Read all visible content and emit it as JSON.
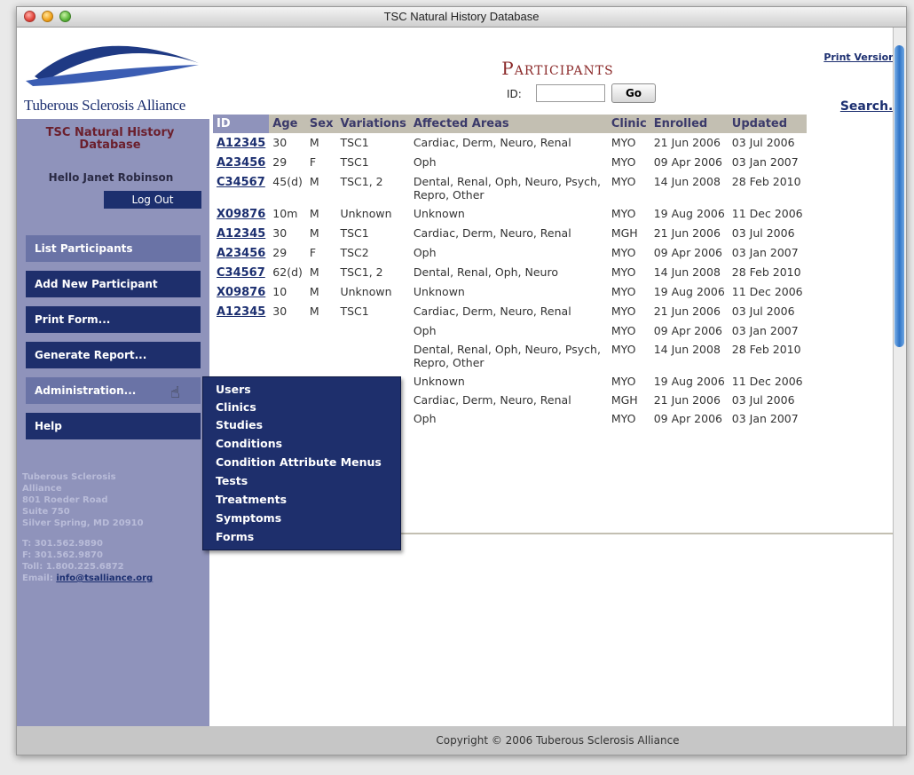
{
  "window": {
    "title": "TSC Natural History Database"
  },
  "sidebar": {
    "logo_text": "Tuberous Sclerosis Alliance",
    "db_title": "TSC Natural History Database",
    "hello": "Hello Janet Robinson",
    "logout": "Log Out",
    "nav": [
      "List Participants",
      "Add New Participant",
      "Print Form...",
      "Generate Report...",
      "Administration...",
      "Help"
    ],
    "address": {
      "line1": "Tuberous Sclerosis",
      "line2": "Alliance",
      "line3": "801 Roeder Road",
      "line4": "Suite 750",
      "line5": "Silver Spring, MD 20910",
      "phone": "T: 301.562.9890",
      "fax": "F: 301.562.9870",
      "tollfree": "Toll: 1.800.225.6872",
      "email_label": "Email:",
      "email": "info@tsalliance.org"
    }
  },
  "main": {
    "title": "Participants",
    "print_version": "Print Version",
    "id_label": "ID:",
    "id_value": "",
    "go": "Go",
    "search": "Search...",
    "columns": [
      "ID",
      "Age",
      "Sex",
      "Variations",
      "Affected Areas",
      "Clinic",
      "Enrolled",
      "Updated"
    ],
    "rows": [
      [
        "A12345",
        "30",
        "M",
        "TSC1",
        "Cardiac, Derm, Neuro, Renal",
        "MYO",
        "21 Jun 2006",
        "03 Jul 2006"
      ],
      [
        "A23456",
        "29",
        "F",
        "TSC1",
        "Oph",
        "MYO",
        "09 Apr 2006",
        "03 Jan 2007"
      ],
      [
        "C34567",
        "45(d)",
        "M",
        "TSC1, 2",
        "Dental, Renal, Oph, Neuro, Psych, Repro, Other",
        "MYO",
        "14 Jun 2008",
        "28 Feb 2010"
      ],
      [
        "X09876",
        "10m",
        "M",
        "Unknown",
        "Unknown",
        "MYO",
        "19 Aug 2006",
        "11 Dec 2006"
      ],
      [
        "A12345",
        "30",
        "M",
        "TSC1",
        "Cardiac, Derm, Neuro, Renal",
        "MGH",
        "21 Jun 2006",
        "03 Jul 2006"
      ],
      [
        "A23456",
        "29",
        "F",
        "TSC2",
        "Oph",
        "MYO",
        "09 Apr 2006",
        "03 Jan 2007"
      ],
      [
        "C34567",
        "62(d)",
        "M",
        "TSC1, 2",
        "Dental, Renal, Oph, Neuro",
        "MYO",
        "14 Jun 2008",
        "28 Feb 2010"
      ],
      [
        "X09876",
        "10",
        "M",
        "Unknown",
        "Unknown",
        "MYO",
        "19 Aug 2006",
        "11 Dec 2006"
      ],
      [
        "A12345",
        "30",
        "M",
        "TSC1",
        "Cardiac, Derm, Neuro, Renal",
        "MYO",
        "21 Jun 2006",
        "03 Jul 2006"
      ],
      [
        "",
        "",
        "",
        "",
        "Oph",
        "MYO",
        "09 Apr 2006",
        "03 Jan 2007"
      ],
      [
        "",
        "",
        "",
        "",
        "Dental, Renal, Oph, Neuro, Psych, Repro, Other",
        "MYO",
        "14 Jun 2008",
        "28 Feb 2010"
      ],
      [
        "",
        "",
        "",
        "",
        "Unknown",
        "MYO",
        "19 Aug 2006",
        "11 Dec 2006"
      ],
      [
        "",
        "",
        "",
        "",
        "Cardiac, Derm, Neuro, Renal",
        "MGH",
        "21 Jun 2006",
        "03 Jul 2006"
      ],
      [
        "",
        "",
        "",
        "",
        "Oph",
        "MYO",
        "09 Apr 2006",
        "03 Jan 2007"
      ]
    ]
  },
  "admin_menu": {
    "items": [
      "Users",
      "Clinics",
      "Studies",
      "Conditions",
      "Condition Attribute Menus",
      "Tests",
      "Treatments",
      "Symptoms",
      "Forms"
    ]
  },
  "footer": {
    "copyright": "Copyright © 2006 Tuberous Sclerosis Alliance"
  },
  "colors": {
    "nav_dark": "#1e2f6c",
    "sidebar_bg": "#8f93bb",
    "title_red": "#8b2a2a",
    "header_tan": "#c3bfb2"
  }
}
